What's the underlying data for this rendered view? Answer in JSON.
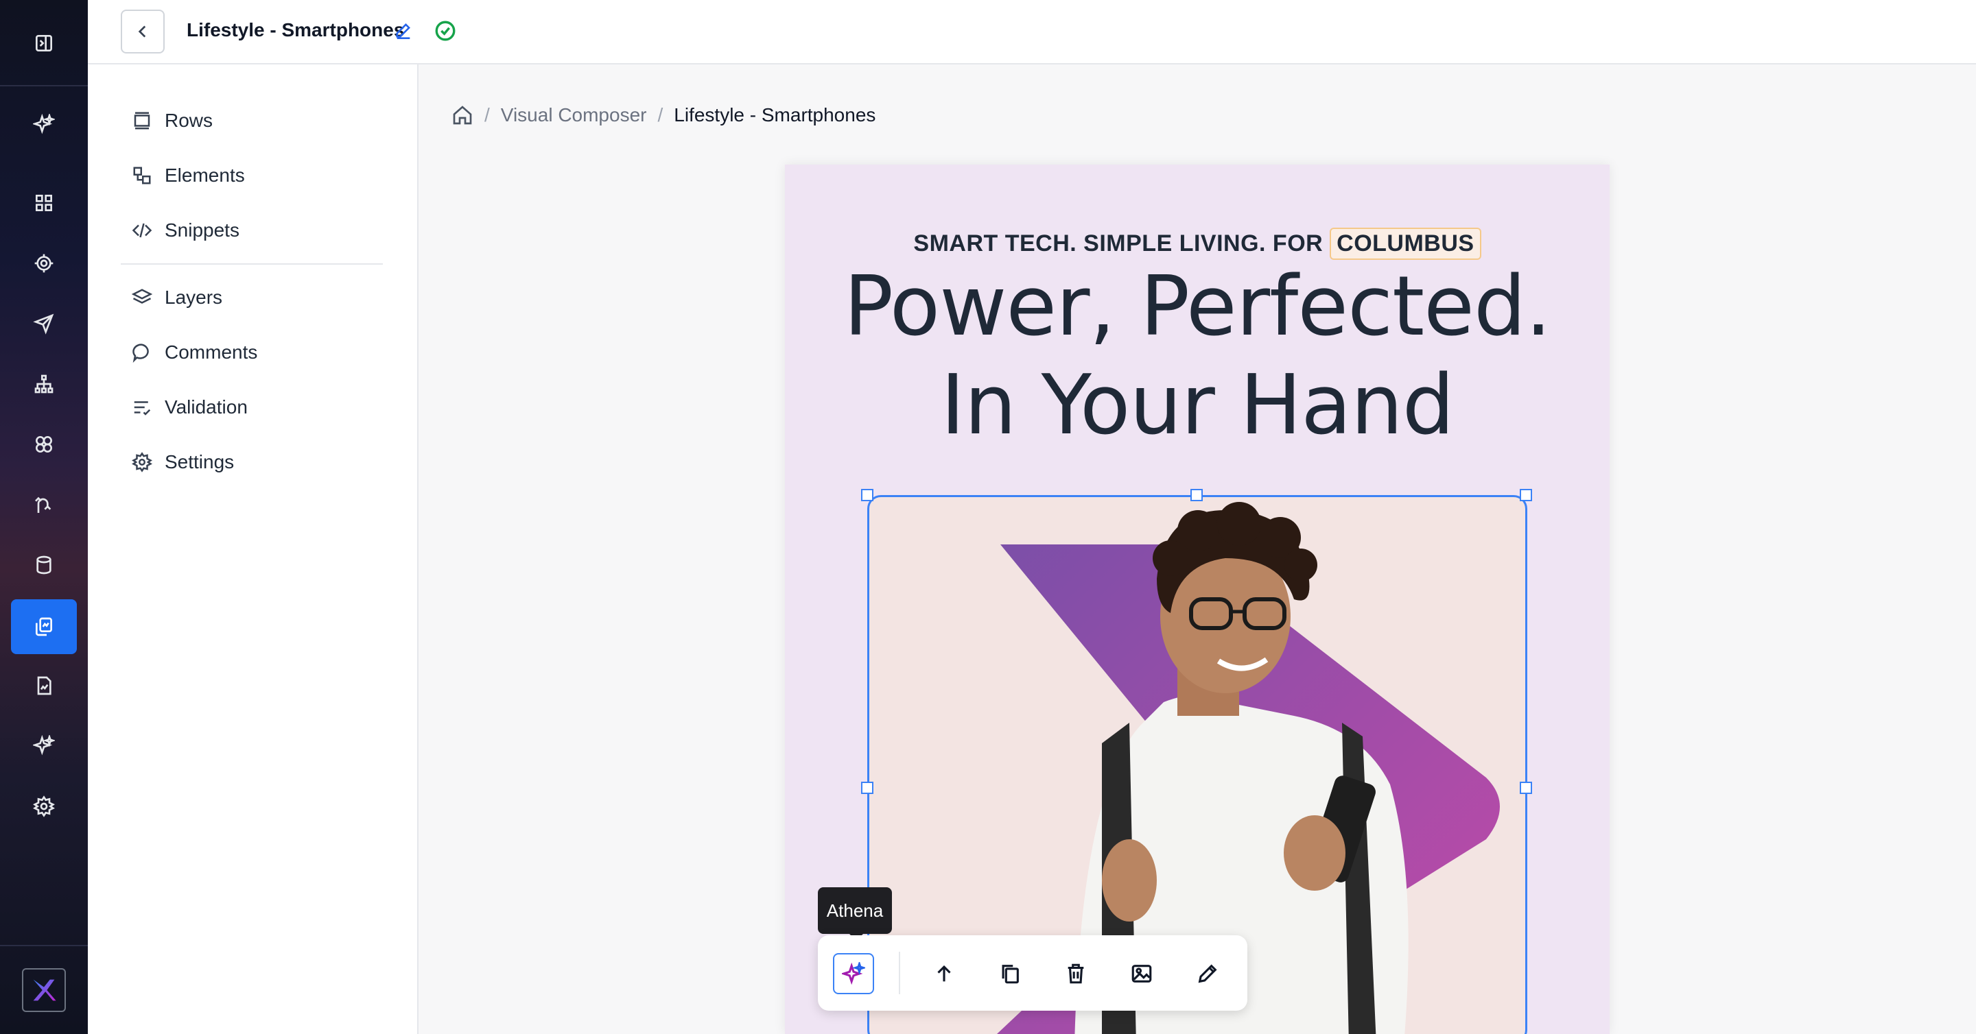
{
  "app": {
    "title": "Lifestyle - Smartphones"
  },
  "rail": {
    "items": [
      {
        "icon": "sidebar-toggle-icon"
      },
      {
        "icon": "sparkle-icon"
      },
      {
        "icon": "dashboard-grid-icon"
      },
      {
        "icon": "target-icon"
      },
      {
        "icon": "send-icon"
      },
      {
        "icon": "hierarchy-icon"
      },
      {
        "icon": "segments-icon"
      },
      {
        "icon": "journey-icon"
      },
      {
        "icon": "database-icon"
      },
      {
        "icon": "content-copy-icon"
      },
      {
        "icon": "report-icon"
      },
      {
        "icon": "ai-sparkle-icon"
      },
      {
        "icon": "settings-gear-icon"
      }
    ],
    "active_index": 9
  },
  "panel": {
    "items": [
      {
        "label": "Rows",
        "icon": "rows-icon"
      },
      {
        "label": "Elements",
        "icon": "elements-icon"
      },
      {
        "label": "Snippets",
        "icon": "code-icon"
      },
      {
        "label": "Layers",
        "icon": "layers-icon"
      },
      {
        "label": "Comments",
        "icon": "comment-icon"
      },
      {
        "label": "Validation",
        "icon": "checklist-icon"
      },
      {
        "label": "Settings",
        "icon": "gear-icon"
      }
    ]
  },
  "breadcrumb": {
    "sep": "/",
    "items": [
      "Visual Composer",
      "Lifestyle - Smartphones"
    ]
  },
  "poster": {
    "tagline": "SMART TECH. SIMPLE LIVING. FOR",
    "city": "COLUMBUS",
    "headline_line1": "Power, Perfected.",
    "headline_line2": "In Your Hand",
    "colors": {
      "background": "#efe4f3",
      "accent_gradient_start": "#7b4fa8",
      "accent_gradient_end": "#c24aa8"
    }
  },
  "toolbar": {
    "tooltip": "Athena",
    "buttons": [
      "ai-sparkle-icon",
      "arrow-up-icon",
      "duplicate-icon",
      "trash-icon",
      "image-icon",
      "pencil-icon"
    ]
  }
}
